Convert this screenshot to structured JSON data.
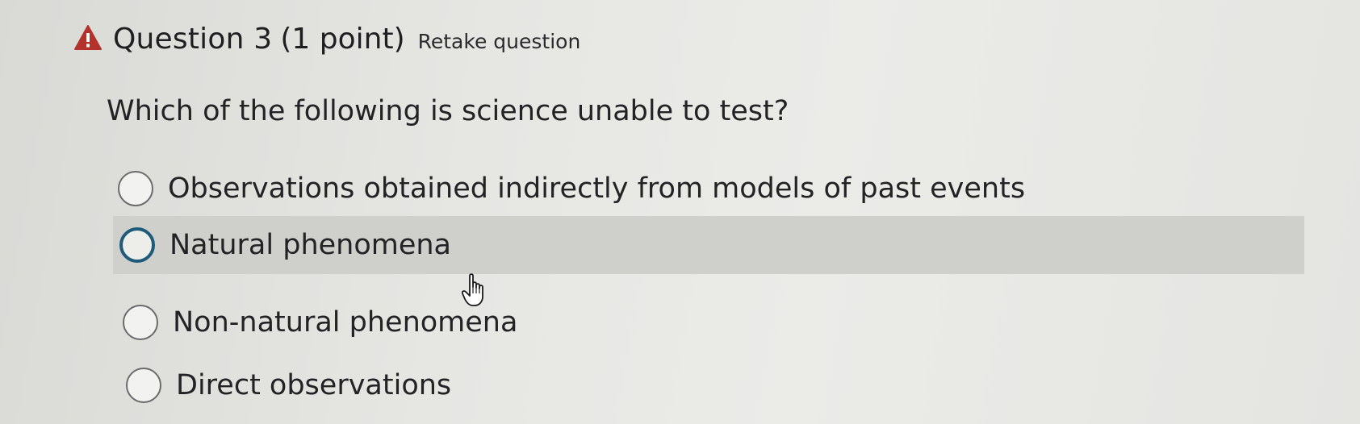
{
  "header": {
    "icon": "warning-triangle-icon",
    "title": "Question 3",
    "points": "(1 point)",
    "retake_link": "Retake question"
  },
  "question": {
    "text": "Which of the following is science unable to test?"
  },
  "options": [
    {
      "label": "Observations obtained indirectly from models of past events"
    },
    {
      "label": "Natural phenomena"
    },
    {
      "label": "Non-natural phenomena"
    },
    {
      "label": "Direct observations"
    }
  ],
  "colors": {
    "warning": "#b3332c",
    "focus_ring": "#1f5a7a",
    "hover_row": "#cfcfcc",
    "background": "#e6e6e3"
  },
  "cursor": "hand-pointer-icon"
}
